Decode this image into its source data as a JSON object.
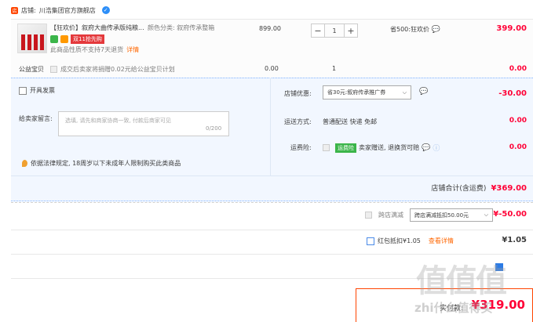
{
  "shop": {
    "prefix": "店铺:",
    "name": "川浩集团官方旗舰店"
  },
  "item": {
    "title": "【狂欢价】叙府大曲传承版纯粮...",
    "sku_label": "颜色分类: 叙府传承整箱",
    "promo_badge": "双11抢先购",
    "refund_note": "此商品性质不支持7天退货",
    "refund_link": "详情",
    "price": "899.00",
    "quantity": "1",
    "minus": "−",
    "plus": "+",
    "save_note": "省500:狂欢价",
    "total": "399.00"
  },
  "welfare": {
    "label": "公益宝贝",
    "text": "成交后卖家将捐赠0.02元给公益宝贝计划",
    "price": "0.00",
    "qty": "1",
    "total": "0.00"
  },
  "order": {
    "invoice_label": "开具发票",
    "message_label": "给卖家留言:",
    "message_placeholder": "选填, 请先和商家协商一致, 付款后商家可见",
    "message_count": "0/200",
    "law_note": "依据法律规定, 18周岁以下未成年人限制购买此类商品",
    "shop_discount_label": "店铺优惠:",
    "shop_discount_option": "省30元:叙府传承推广券",
    "shop_discount_value": "-30.00",
    "shipping_label": "运送方式:",
    "shipping_value": "普通配送 快递 免邮",
    "shipping_price": "0.00",
    "insurance_label": "运费险:",
    "insurance_tag": "运费险",
    "insurance_text": "卖家赠送, 退换货可赔",
    "insurance_price": "0.00",
    "subtotal_label": "店铺合计(含运费)",
    "subtotal_value": "¥369.00"
  },
  "cross_store": {
    "label": "跨店满减",
    "option": "跨店满减抵扣50.00元",
    "value": "¥-50.00"
  },
  "hongbao": {
    "label": "红包抵扣¥1.05",
    "link": "查看详情",
    "value": "¥1.05"
  },
  "payment": {
    "label": "实付款:",
    "amount": "¥319.00"
  },
  "watermark": {
    "big": "值值值",
    "small": "zhi什么值得买"
  },
  "colors": {
    "accent": "#ff0036",
    "shop": "#ff4400",
    "panel": "#f2f7ff",
    "link": "#ff6600"
  }
}
